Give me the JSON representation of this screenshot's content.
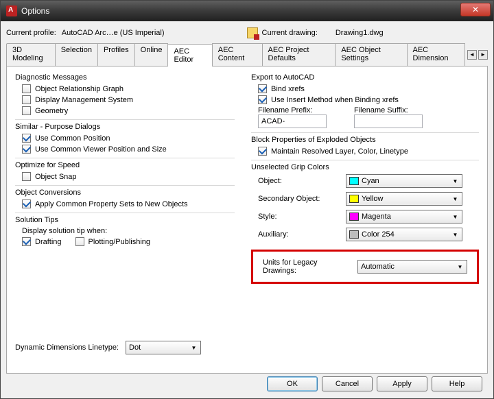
{
  "window": {
    "title": "Options"
  },
  "profile": {
    "label": "Current profile:",
    "value": "AutoCAD Arc…e (US Imperial)"
  },
  "drawing": {
    "label": "Current drawing:",
    "value": "Drawing1.dwg"
  },
  "tabs": {
    "t0": "3D Modeling",
    "t1": "Selection",
    "t2": "Profiles",
    "t3": "Online",
    "t4": "AEC Editor",
    "t5": "AEC Content",
    "t6": "AEC Project Defaults",
    "t7": "AEC Object Settings",
    "t8": "AEC Dimension"
  },
  "left": {
    "diag": {
      "title": "Diagnostic Messages",
      "org": "Object Relationship Graph",
      "dms": "Display Management System",
      "geo": "Geometry"
    },
    "sim": {
      "title": "Similar - Purpose Dialogs",
      "ucp": "Use Common Position",
      "ucv": "Use Common Viewer Position and Size"
    },
    "opt": {
      "title": "Optimize for Speed",
      "os": "Object Snap"
    },
    "conv": {
      "title": "Object Conversions",
      "apply": "Apply Common Property Sets to New Objects"
    },
    "sol": {
      "title": "Solution Tips",
      "when": "Display solution tip when:",
      "draft": "Drafting",
      "plot": "Plotting/Publishing"
    },
    "dyn": {
      "label": "Dynamic Dimensions Linetype:",
      "value": "Dot"
    }
  },
  "right": {
    "export": {
      "title": "Export to AutoCAD",
      "bind": "Bind xrefs",
      "insert": "Use Insert Method when Binding xrefs",
      "pref_lbl": "Filename Prefix:",
      "pref_val": "ACAD-",
      "suf_lbl": "Filename Suffix:",
      "suf_val": ""
    },
    "block": {
      "title": "Block Properties of Exploded Objects",
      "maintain": "Maintain Resolved Layer, Color, Linetype"
    },
    "grip": {
      "title": "Unselected Grip Colors",
      "obj_lbl": "Object:",
      "obj_val": "Cyan",
      "obj_color": "#00ffff",
      "sec_lbl": "Secondary Object:",
      "sec_val": "Yellow",
      "sec_color": "#ffff00",
      "sty_lbl": "Style:",
      "sty_val": "Magenta",
      "sty_color": "#ff00ff",
      "aux_lbl": "Auxiliary:",
      "aux_val": "Color 254",
      "aux_color": "#bdbdbd"
    },
    "legacy": {
      "label": "Units for Legacy Drawings:",
      "value": "Automatic"
    }
  },
  "buttons": {
    "ok": "OK",
    "cancel": "Cancel",
    "apply": "Apply",
    "help": "Help"
  }
}
